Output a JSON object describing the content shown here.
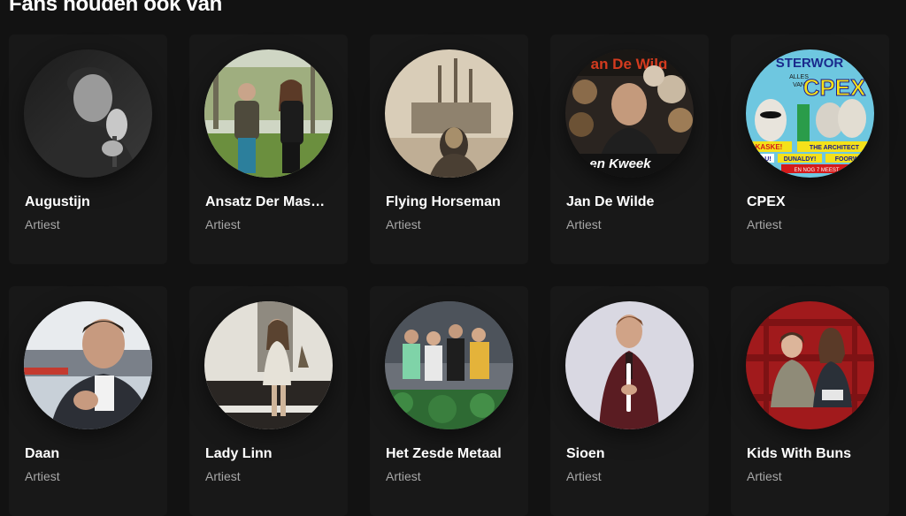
{
  "section": {
    "title": "Fans houden ook van"
  },
  "artists": [
    {
      "name": "Augustijn",
      "subtitle": "Artiest"
    },
    {
      "name": "Ansatz Der Mas…",
      "subtitle": "Artiest"
    },
    {
      "name": "Flying Horseman",
      "subtitle": "Artiest"
    },
    {
      "name": "Jan De Wilde",
      "subtitle": "Artiest"
    },
    {
      "name": "CPEX",
      "subtitle": "Artiest"
    },
    {
      "name": "Daan",
      "subtitle": "Artiest"
    },
    {
      "name": "Lady Linn",
      "subtitle": "Artiest"
    },
    {
      "name": "Het Zesde Metaal",
      "subtitle": "Artiest"
    },
    {
      "name": "Sioen",
      "subtitle": "Artiest"
    },
    {
      "name": "Kids With Buns",
      "subtitle": "Artiest"
    }
  ],
  "photo_text": {
    "jandewilde_top": "an De Wild",
    "jandewilde_bottom": "en Kweek",
    "cpex_banner": "STERWOR",
    "cpex_alles": "ALLES",
    "cpex_van": "VAN",
    "cpex_logo": "CPEX",
    "cpex_tag1": "KASKE!",
    "cpex_tag2": "THE ARCHITECT",
    "cpex_tag3": "KE LU!",
    "cpex_tag4": "DUNALDY!",
    "cpex_tag5": "FOORWIJ",
    "cpex_tag6": "EN NOG 7 MEEST"
  },
  "colors": {
    "background": "#121212",
    "card": "#181818",
    "title": "#ffffff",
    "subtitle": "#a7a7a7"
  }
}
